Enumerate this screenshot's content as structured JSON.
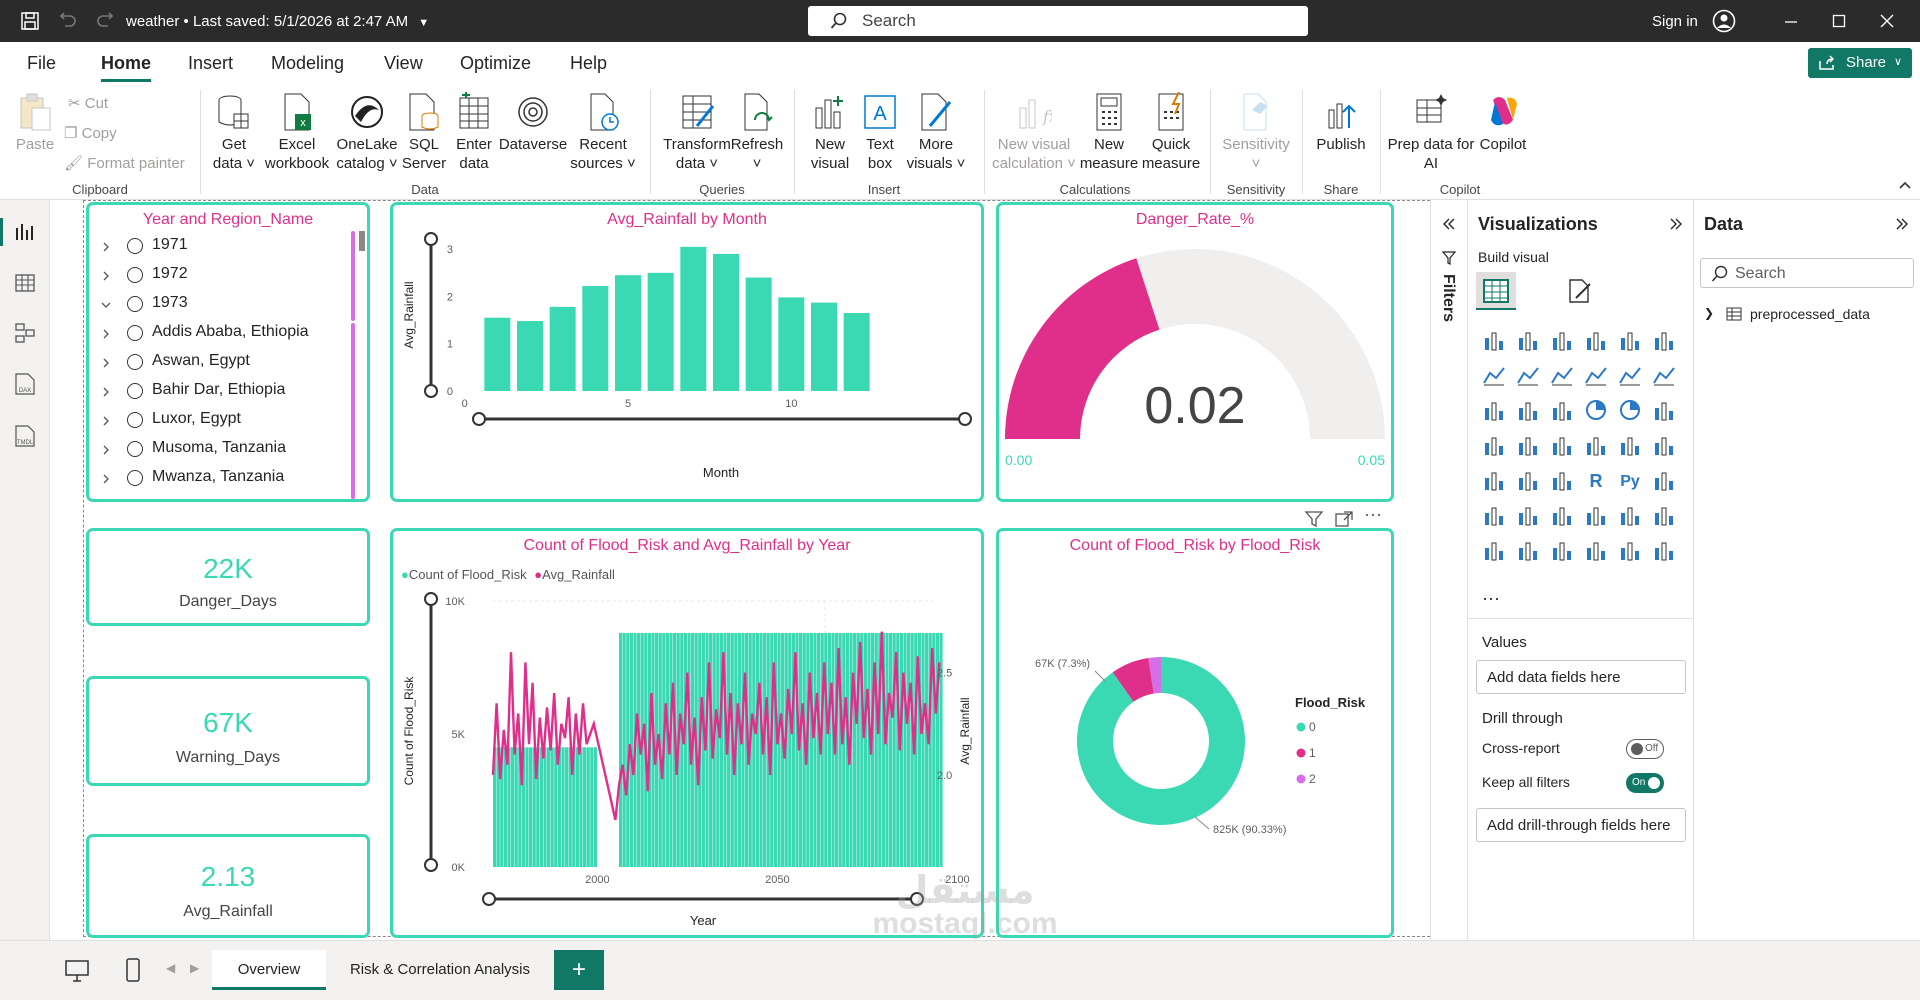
{
  "titlebar": {
    "doc_title": "weather",
    "saved": "Last saved: 5/1/2026 at 2:47 AM",
    "search_placeholder": "Search",
    "signin": "Sign in"
  },
  "menu": [
    "File",
    "Home",
    "Insert",
    "Modeling",
    "View",
    "Optimize",
    "Help"
  ],
  "menu_active": "Home",
  "share_label": "Share",
  "ribbon": {
    "clipboard": {
      "paste": "Paste",
      "cut": "Cut",
      "copy": "Copy",
      "format_painter": "Format painter",
      "group": "Clipboard"
    },
    "data": {
      "get_data": [
        "Get",
        "data"
      ],
      "excel": [
        "Excel",
        "workbook"
      ],
      "onelake": [
        "OneLake",
        "catalog"
      ],
      "sql": [
        "SQL",
        "Server"
      ],
      "enter": [
        "Enter",
        "data"
      ],
      "dataverse": [
        "Dataverse",
        ""
      ],
      "recent": [
        "Recent",
        "sources"
      ],
      "group": "Data"
    },
    "queries": {
      "transform": [
        "Transform",
        "data"
      ],
      "refresh": [
        "Refresh",
        ""
      ],
      "group": "Queries"
    },
    "insert": {
      "new_visual": [
        "New",
        "visual"
      ],
      "text_box": [
        "Text",
        "box"
      ],
      "more_visuals": [
        "More",
        "visuals"
      ],
      "group": "Insert"
    },
    "calculations": {
      "new_visual_calc": [
        "New visual",
        "calculation"
      ],
      "new_measure": [
        "New",
        "measure"
      ],
      "quick_measure": [
        "Quick",
        "measure"
      ],
      "group": "Calculations"
    },
    "sensitivity": {
      "label": "Sensitivity",
      "group": "Sensitivity"
    },
    "share": {
      "publish": "Publish",
      "group": "Share"
    },
    "copilot": {
      "prep": [
        "Prep data for",
        "AI"
      ],
      "copilot": "Copilot",
      "group": "Copilot"
    }
  },
  "slicer": {
    "title": "Year and Region_Name",
    "items": [
      {
        "label": "1971",
        "expanded": false
      },
      {
        "label": "1972",
        "expanded": false
      },
      {
        "label": "1973",
        "expanded": true
      },
      {
        "label": "Addis Ababa, Ethiopia",
        "expanded": false
      },
      {
        "label": "Aswan, Egypt",
        "expanded": false
      },
      {
        "label": "Bahir Dar, Ethiopia",
        "expanded": false
      },
      {
        "label": "Luxor, Egypt",
        "expanded": false
      },
      {
        "label": "Musoma, Tanzania",
        "expanded": false
      },
      {
        "label": "Mwanza, Tanzania",
        "expanded": false
      }
    ]
  },
  "kpis": [
    {
      "value": "22K",
      "label": "Danger_Days"
    },
    {
      "value": "67K",
      "label": "Warning_Days"
    },
    {
      "value": "2.13",
      "label": "Avg_Rainfall"
    }
  ],
  "gauge": {
    "title": "Danger_Rate_%",
    "value": "0.02",
    "min": "0.00",
    "max": "0.05",
    "fraction": 0.4
  },
  "colors": {
    "teal": "#3ad9b4",
    "pink": "#e02f8a",
    "violet": "#d66ee6",
    "track": "#f0efee",
    "share": "#117865"
  },
  "chart_data": [
    {
      "type": "bar",
      "title": "Avg_Rainfall by Month",
      "xlabel": "Month",
      "ylabel": "Avg_Rainfall",
      "categories": [
        1,
        2,
        3,
        4,
        5,
        6,
        7,
        8,
        9,
        10,
        11,
        12
      ],
      "values": [
        1.55,
        1.48,
        1.78,
        2.22,
        2.45,
        2.5,
        3.05,
        2.9,
        2.4,
        1.98,
        1.87,
        1.65
      ],
      "ylim": [
        0,
        3.3
      ],
      "xticks": [
        "0",
        "5",
        "10"
      ],
      "yticks": [
        "0",
        "1",
        "2",
        "3"
      ]
    },
    {
      "type": "bar+line",
      "title": "Count of Flood_Risk and Avg_Rainfall by Year",
      "xlabel": "Year",
      "ylabel": "Count of Flood_Risk",
      "ylabel2": "Avg_Rainfall",
      "legend": [
        "Count of Flood_Risk",
        "Avg_Rainfall"
      ],
      "xticks": [
        "2000",
        "2050",
        "2100"
      ],
      "yticks": [
        "0K",
        "5K",
        "10K"
      ],
      "y2ticks": [
        "2.0",
        "2.5"
      ],
      "x_range": [
        1971,
        2100
      ],
      "bar_segments": [
        {
          "from": 1971,
          "to": 1999,
          "count": 4500
        },
        {
          "from": 2006,
          "to": 2095,
          "count": 8800
        }
      ],
      "line": [
        [
          1971,
          2.0
        ],
        [
          1972,
          2.35
        ],
        [
          1973,
          1.98
        ],
        [
          1974,
          2.22
        ],
        [
          1975,
          2.05
        ],
        [
          1976,
          2.6
        ],
        [
          1977,
          2.1
        ],
        [
          1978,
          2.3
        ],
        [
          1979,
          1.95
        ],
        [
          1980,
          2.55
        ],
        [
          1981,
          2.15
        ],
        [
          1982,
          2.45
        ],
        [
          1983,
          1.98
        ],
        [
          1984,
          2.28
        ],
        [
          1985,
          2.08
        ],
        [
          1986,
          2.33
        ],
        [
          1987,
          2.12
        ],
        [
          1988,
          2.4
        ],
        [
          1989,
          2.05
        ],
        [
          1990,
          2.25
        ],
        [
          1991,
          2.18
        ],
        [
          1992,
          2.38
        ],
        [
          1993,
          2.0
        ],
        [
          1994,
          2.3
        ],
        [
          1995,
          2.1
        ],
        [
          1996,
          2.35
        ],
        [
          1997,
          2.15
        ],
        [
          1998,
          2.2
        ],
        [
          1999,
          2.25
        ],
        [
          2005,
          1.78
        ],
        [
          2006,
          1.95
        ],
        [
          2007,
          2.05
        ],
        [
          2008,
          1.9
        ],
        [
          2009,
          2.15
        ],
        [
          2010,
          2.0
        ],
        [
          2011,
          2.3
        ],
        [
          2012,
          2.1
        ],
        [
          2013,
          2.25
        ],
        [
          2014,
          1.92
        ],
        [
          2015,
          2.4
        ],
        [
          2016,
          2.05
        ],
        [
          2017,
          2.2
        ],
        [
          2018,
          1.98
        ],
        [
          2019,
          2.35
        ],
        [
          2020,
          2.1
        ],
        [
          2021,
          2.45
        ],
        [
          2022,
          2.0
        ],
        [
          2023,
          2.3
        ],
        [
          2024,
          2.15
        ],
        [
          2025,
          2.5
        ],
        [
          2026,
          2.05
        ],
        [
          2027,
          2.28
        ],
        [
          2028,
          1.95
        ],
        [
          2029,
          2.38
        ],
        [
          2030,
          2.12
        ],
        [
          2031,
          2.55
        ],
        [
          2032,
          2.08
        ],
        [
          2033,
          2.32
        ],
        [
          2034,
          2.18
        ],
        [
          2035,
          2.6
        ],
        [
          2036,
          2.1
        ],
        [
          2037,
          2.4
        ],
        [
          2038,
          2.0
        ],
        [
          2039,
          2.35
        ],
        [
          2040,
          2.15
        ],
        [
          2041,
          2.5
        ],
        [
          2042,
          2.05
        ],
        [
          2043,
          2.3
        ],
        [
          2044,
          2.2
        ],
        [
          2045,
          2.45
        ],
        [
          2046,
          2.1
        ],
        [
          2047,
          2.38
        ],
        [
          2048,
          2.0
        ],
        [
          2049,
          2.55
        ],
        [
          2050,
          2.15
        ],
        [
          2051,
          2.3
        ],
        [
          2052,
          2.08
        ],
        [
          2053,
          2.42
        ],
        [
          2054,
          2.2
        ],
        [
          2055,
          2.6
        ],
        [
          2056,
          2.12
        ],
        [
          2057,
          2.35
        ],
        [
          2058,
          2.05
        ],
        [
          2059,
          2.5
        ],
        [
          2060,
          2.18
        ],
        [
          2061,
          2.4
        ],
        [
          2062,
          2.1
        ],
        [
          2063,
          2.55
        ],
        [
          2064,
          2.2
        ],
        [
          2065,
          2.45
        ],
        [
          2066,
          2.1
        ],
        [
          2067,
          2.62
        ],
        [
          2068,
          2.15
        ],
        [
          2069,
          2.38
        ],
        [
          2070,
          2.05
        ],
        [
          2071,
          2.5
        ],
        [
          2072,
          2.25
        ],
        [
          2073,
          2.65
        ],
        [
          2074,
          2.18
        ],
        [
          2075,
          2.42
        ],
        [
          2076,
          2.1
        ],
        [
          2077,
          2.55
        ],
        [
          2078,
          2.2
        ],
        [
          2079,
          2.7
        ],
        [
          2080,
          2.15
        ],
        [
          2081,
          2.4
        ],
        [
          2082,
          2.28
        ],
        [
          2083,
          2.6
        ],
        [
          2084,
          2.12
        ],
        [
          2085,
          2.5
        ],
        [
          2086,
          2.25
        ],
        [
          2087,
          2.45
        ],
        [
          2088,
          2.1
        ],
        [
          2089,
          2.58
        ],
        [
          2090,
          2.2
        ],
        [
          2091,
          2.35
        ],
        [
          2092,
          2.15
        ],
        [
          2093,
          2.62
        ],
        [
          2094,
          2.3
        ],
        [
          2095,
          2.55
        ]
      ]
    },
    {
      "type": "pie",
      "title": "Count of Flood_Risk by Flood_Risk",
      "legend_title": "Flood_Risk",
      "categories": [
        "0",
        "1",
        "2"
      ],
      "values": [
        825,
        67,
        22
      ],
      "labels": [
        "825K (90.33%)",
        "67K (7.3%)",
        ""
      ]
    }
  ],
  "viz_pane": {
    "title": "Visualizations",
    "build": "Build visual",
    "values": "Values",
    "add_data": "Add data fields here",
    "drill": "Drill through",
    "cross": "Cross-report",
    "cross_state": "Off",
    "keep": "Keep all filters",
    "keep_state": "On",
    "add_drill": "Add drill-through fields here",
    "more": "···"
  },
  "filters_label": "Filters",
  "data_pane": {
    "title": "Data",
    "search": "Search",
    "table": "preprocessed_data"
  },
  "tabs": [
    "Overview",
    "Risk & Correlation Analysis"
  ],
  "tab_add": "+",
  "watermark": [
    "مستقل",
    "mostaql.com"
  ]
}
